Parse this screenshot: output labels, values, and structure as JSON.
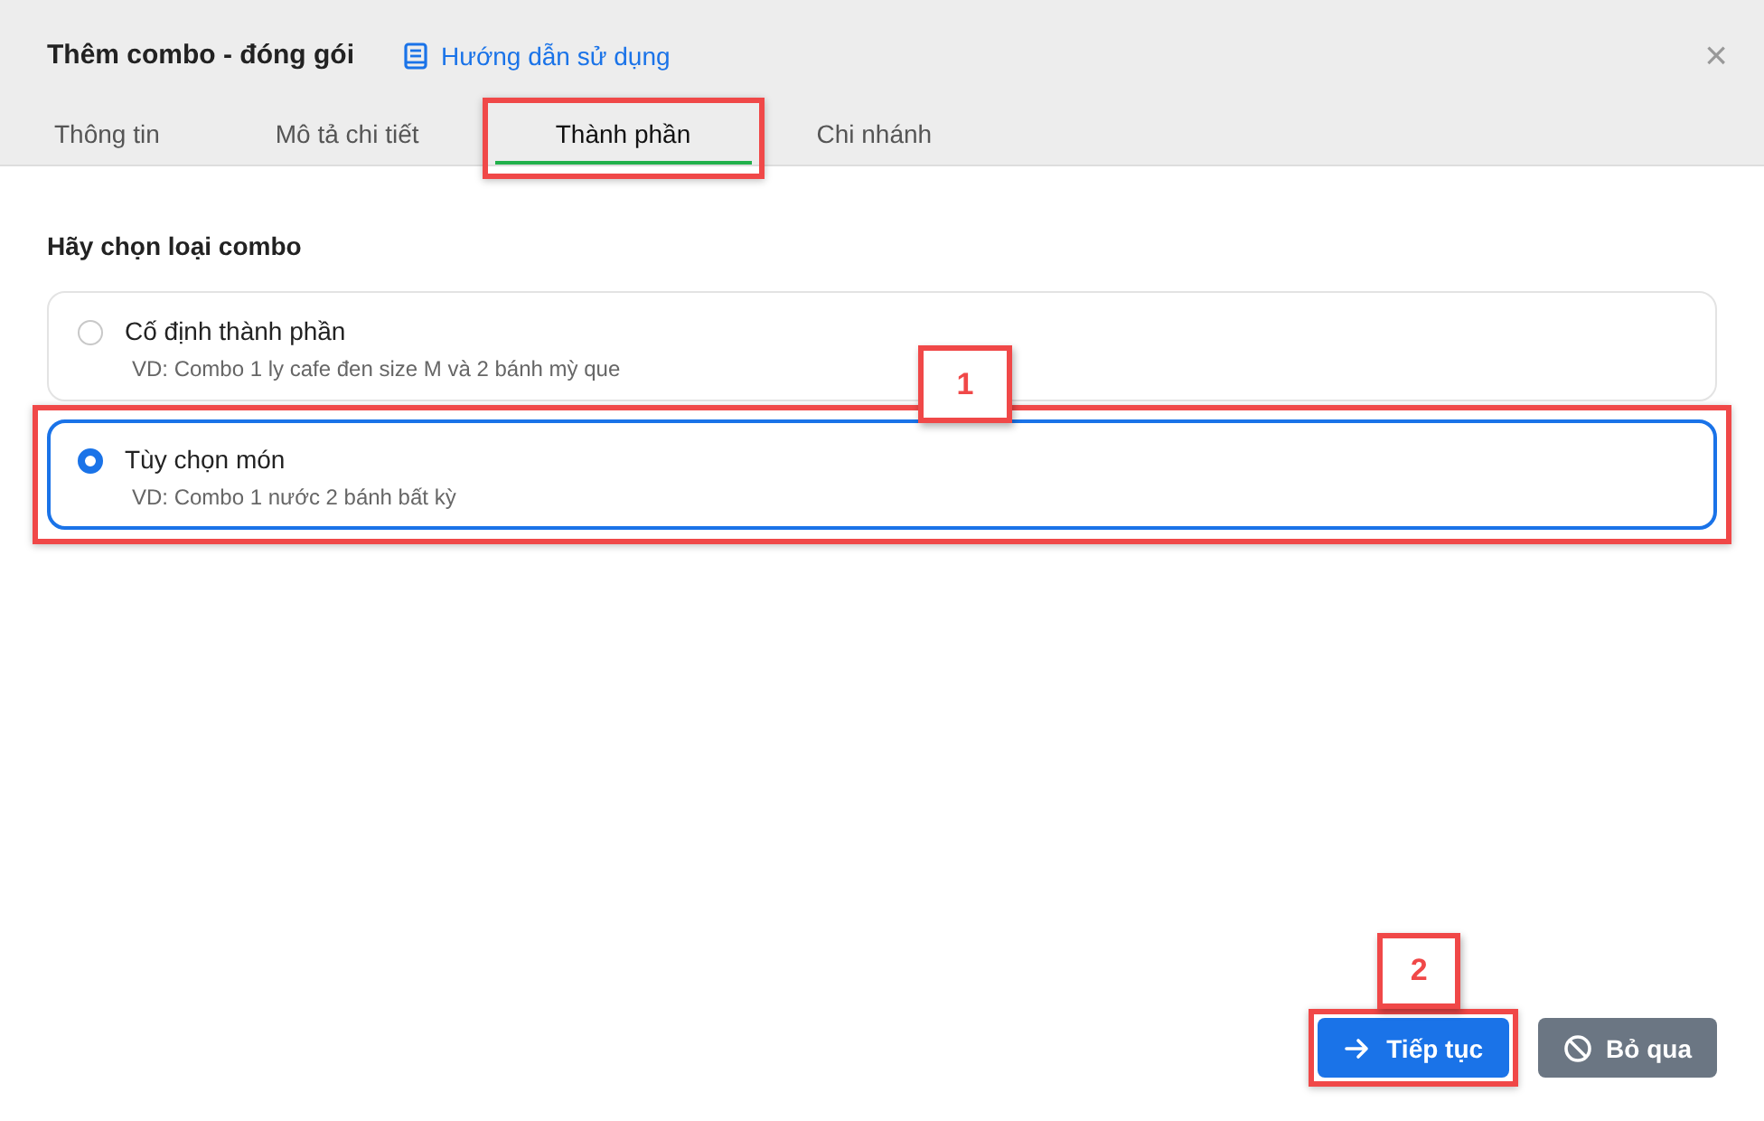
{
  "dialog": {
    "title": "Thêm combo - đóng gói",
    "help_link": "Hướng dẫn sử dụng",
    "close": "×"
  },
  "tabs": [
    {
      "label": "Thông tin",
      "selected": false,
      "highlighted": false
    },
    {
      "label": "Mô tả chi tiết",
      "selected": false,
      "highlighted": false
    },
    {
      "label": "Thành phần",
      "selected": true,
      "highlighted": true
    },
    {
      "label": "Chi nhánh",
      "selected": false,
      "highlighted": false
    }
  ],
  "section_label": "Hãy chọn loại combo",
  "options": [
    {
      "title": "Cố định thành phần",
      "example": "VD: Combo 1 ly cafe đen size M và 2 bánh mỳ que",
      "selected": false,
      "highlighted": false
    },
    {
      "title": "Tùy chọn món",
      "example": "VD: Combo 1 nước 2 bánh bất kỳ",
      "selected": true,
      "highlighted": true,
      "callout": "1"
    }
  ],
  "buttons": [
    {
      "kind": "next",
      "label": "Tiếp tục",
      "highlighted": true,
      "callout": "2"
    },
    {
      "kind": "skip",
      "label": "Bỏ qua",
      "highlighted": false
    }
  ]
}
